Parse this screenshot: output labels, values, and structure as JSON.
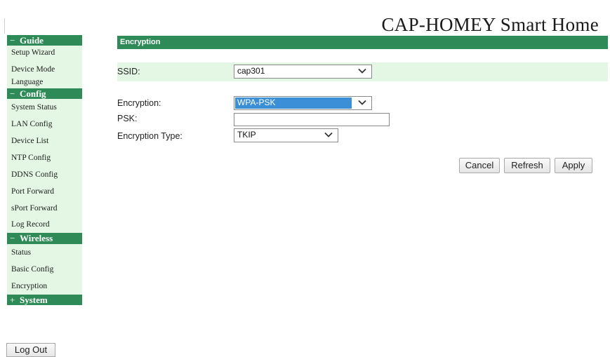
{
  "header": {
    "title": "CAP-HOMEY Smart Home"
  },
  "sidebar": {
    "sections": [
      {
        "sign": "−",
        "label": "Guide",
        "items": [
          "Setup Wizard",
          "Device Mode",
          "Language"
        ]
      },
      {
        "sign": "−",
        "label": "Config",
        "items": [
          "System Status",
          "LAN Config",
          "Device List",
          "NTP Config",
          "DDNS Config",
          "Port Forward",
          "sPort Forward",
          "Log Record"
        ]
      },
      {
        "sign": "−",
        "label": "Wireless",
        "items": [
          "Status",
          "Basic Config",
          "Encryption"
        ]
      },
      {
        "sign": "+",
        "label": "System",
        "items": []
      }
    ],
    "logout_label": "Log Out"
  },
  "main": {
    "section_title": "Encryption",
    "ssid": {
      "label": "SSID:",
      "value": "cap301"
    },
    "encryption": {
      "label": "Encryption:",
      "value": "WPA-PSK"
    },
    "psk": {
      "label": "PSK:",
      "value": ""
    },
    "encryption_type": {
      "label": "Encryption Type:",
      "value": "TKIP"
    },
    "buttons": {
      "cancel": "Cancel",
      "refresh": "Refresh",
      "apply": "Apply"
    }
  },
  "colors": {
    "accent": "#2e8b57",
    "row_bg": "#e4f7e4",
    "select_highlight": "#3b8fd6"
  }
}
